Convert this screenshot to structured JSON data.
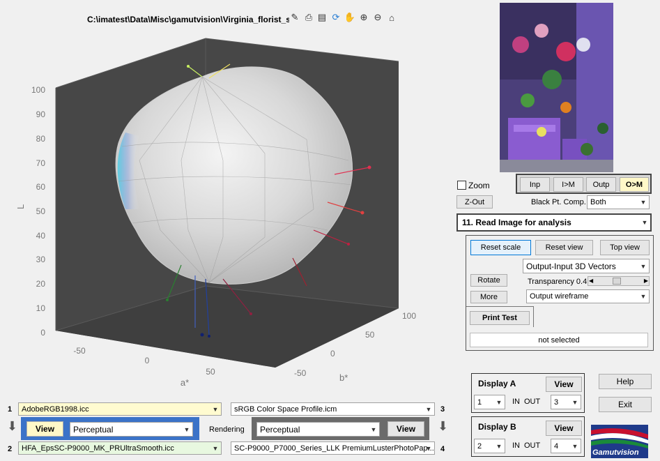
{
  "figure": {
    "title": "C:\\imatest\\Data\\Misc\\gamutvision\\Virginia_florist_s",
    "axes": {
      "l_label": "L",
      "a_label": "a*",
      "b_label": "b*",
      "l_ticks": [
        "100",
        "90",
        "80",
        "70",
        "60",
        "50",
        "40",
        "30",
        "20",
        "10",
        "0"
      ],
      "a_ticks": [
        "-50",
        "0",
        "50"
      ],
      "b_ticks": [
        "100",
        "50",
        "0",
        "-50"
      ]
    },
    "toolbar_icons": [
      "brush-icon",
      "print-icon",
      "data-tips-icon",
      "rotate-3d-icon",
      "pan-hand-icon",
      "zoom-in-icon",
      "zoom-out-icon",
      "home-icon"
    ]
  },
  "view_mode": {
    "inp": "Inp",
    "i_m": "I>M",
    "outp": "Outp",
    "o_m": "O>M"
  },
  "zoom_label": "Zoom",
  "zout_label": "Z-Out",
  "black_pt": {
    "label": "Black Pt. Comp.",
    "value": "Both"
  },
  "analysis_select": "11. Read Image for analysis",
  "controls": {
    "reset_scale": "Reset scale",
    "reset_view": "Reset view",
    "top_view": "Top view",
    "vectors_select": "Output-Input 3D Vectors",
    "rotate": "Rotate",
    "transparency_label": "Transparency 0.4",
    "transparency_value": 0.4,
    "more": "More",
    "wireframe_select": "Output wireframe",
    "print_test": "Print Test",
    "status": "not selected"
  },
  "profiles": {
    "n1": "1",
    "n2": "2",
    "n3": "3",
    "n4": "4",
    "p1": "AdobeRGB1998.icc",
    "p2": "HFA_EpsSC-P9000_MK_PRUltraSmooth.icc",
    "p3": "sRGB Color Space Profile.icm",
    "p4": "SC-P9000_P7000_Series_LLK PremiumLusterPhotoPap...",
    "view_left": "View",
    "intent_left": "Perceptual",
    "rendering_label": "Rendering",
    "intent_right": "Perceptual",
    "view_right": "View"
  },
  "display_a": {
    "title": "Display A",
    "view": "View",
    "in_val": "1",
    "in_label": "IN",
    "out_label": "OUT",
    "out_val": "3"
  },
  "display_b": {
    "title": "Display B",
    "view": "View",
    "in_val": "2",
    "in_label": "IN",
    "out_label": "OUT",
    "out_val": "4"
  },
  "help": "Help",
  "exit": "Exit",
  "logo_text": "Gamutvision",
  "colors": {
    "panel_blue": "#3b73c8",
    "panel_gray": "#6b6b6b",
    "plot_bg": "#474747",
    "yellow_field": "#fffbd0",
    "green_field": "#e8f8e0"
  }
}
